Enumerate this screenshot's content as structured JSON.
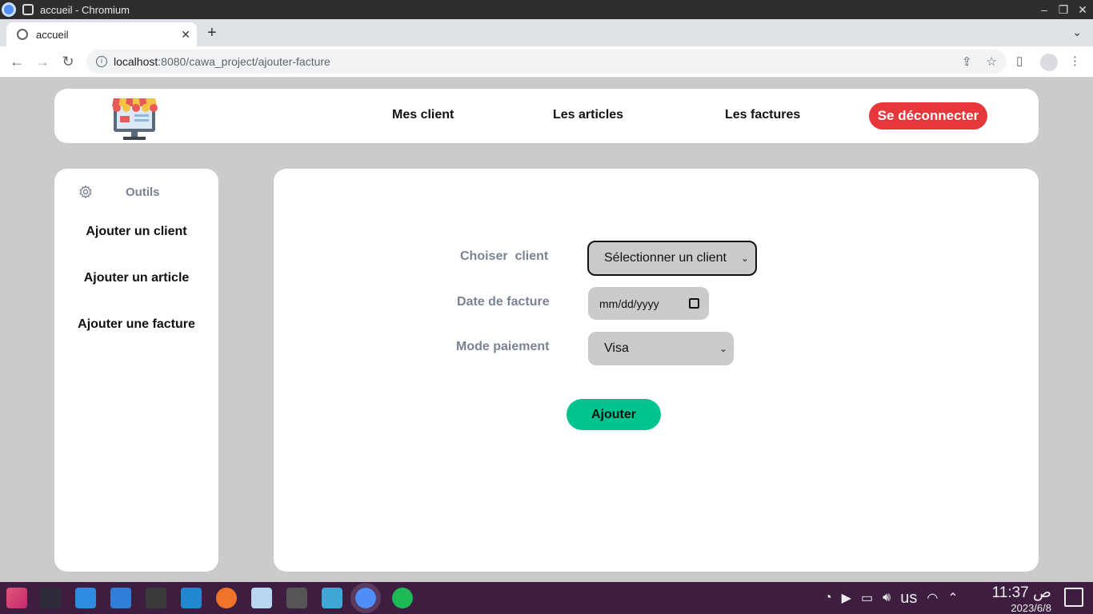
{
  "window": {
    "title": "accueil - Chromium"
  },
  "tab": {
    "label": "accueil",
    "close": "✕",
    "new": "+"
  },
  "address": {
    "host": "localhost",
    "path": ":8080/cawa_project/ajouter-facture"
  },
  "nav": {
    "links": [
      "Mes client",
      "Les articles",
      "Les factures"
    ],
    "logout": "Se déconnecter"
  },
  "sidebar": {
    "heading": "Outils",
    "items": [
      "Ajouter un client",
      "Ajouter un article",
      "Ajouter une facture"
    ]
  },
  "form": {
    "client_label": "Choiser  client",
    "client_value": "Sélectionner un client",
    "date_label": "Date de facture",
    "date_value": "mm/dd/yyyy",
    "mode_label": "Mode paiement",
    "mode_value": "Visa",
    "submit": "Ajouter"
  },
  "taskbar": {
    "keyboard": "us",
    "ampm": "ص",
    "time": "11:37",
    "date": "2023/6/8"
  },
  "colors": {
    "logout": "#e8373a",
    "submit": "#00c48f",
    "page_bg": "#cbcbcb",
    "taskbar": "#3d1e40"
  }
}
